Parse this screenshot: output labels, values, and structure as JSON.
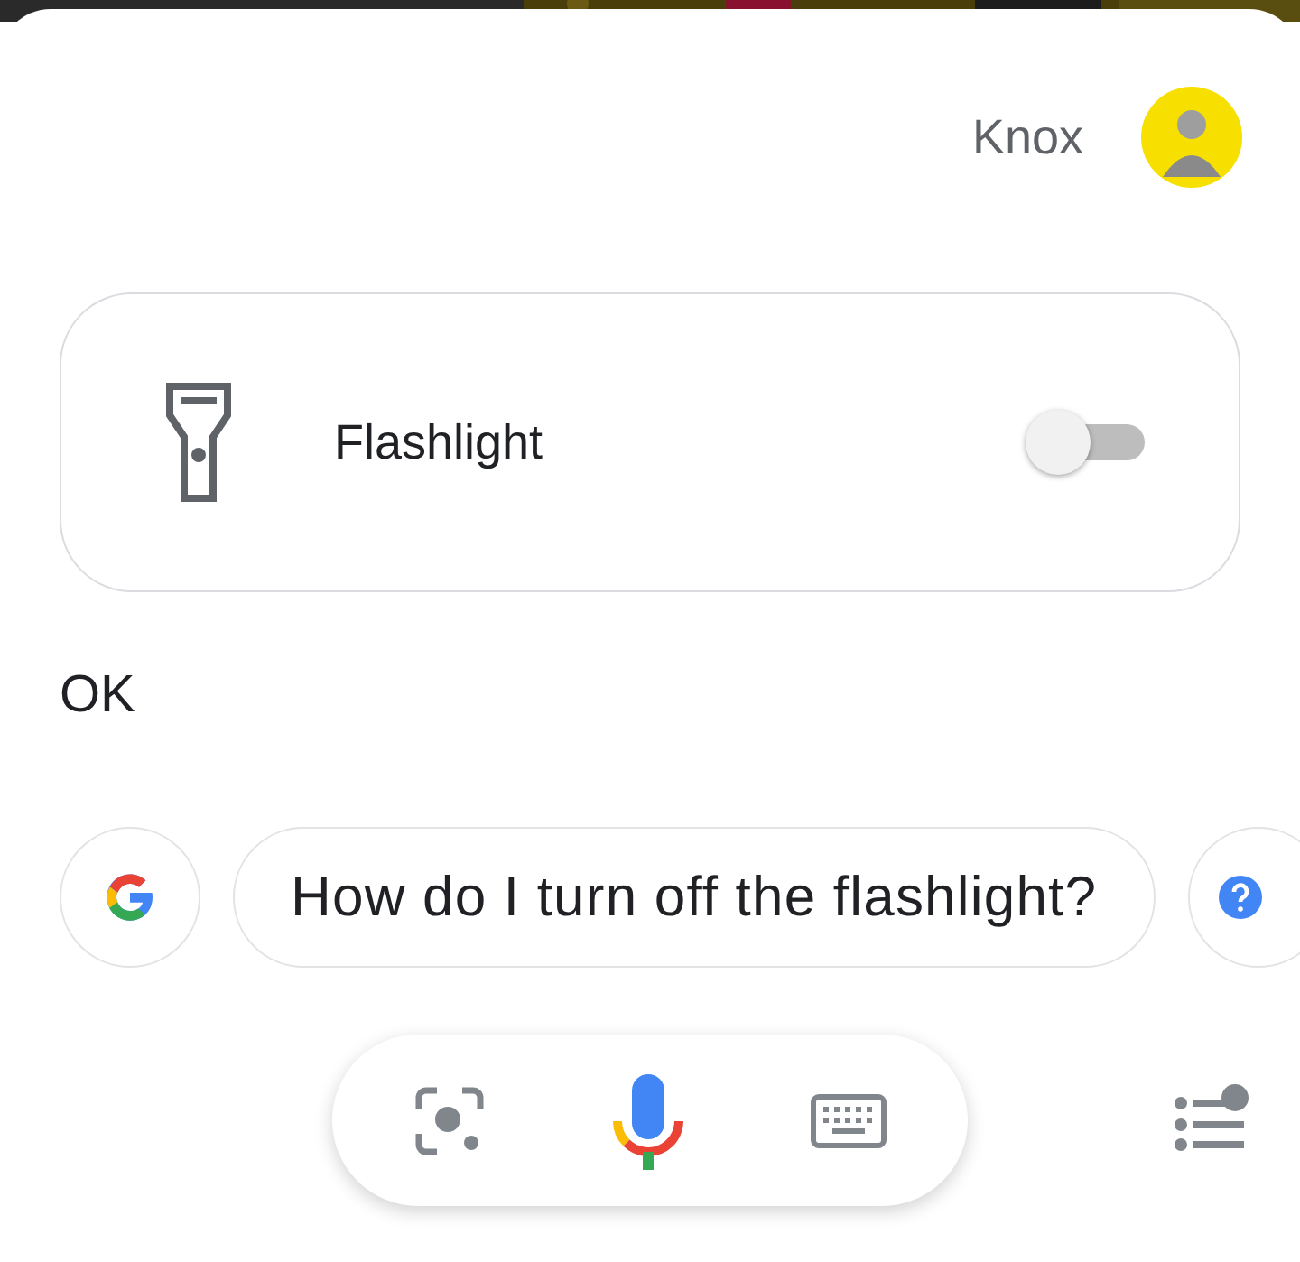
{
  "header": {
    "name": "Knox"
  },
  "card": {
    "title": "Flashlight",
    "on": false
  },
  "response": {
    "text": "OK"
  },
  "suggestions": [
    {
      "kind": "google"
    },
    {
      "kind": "text",
      "label": "How do I turn off the flashlight?"
    },
    {
      "kind": "help"
    }
  ]
}
